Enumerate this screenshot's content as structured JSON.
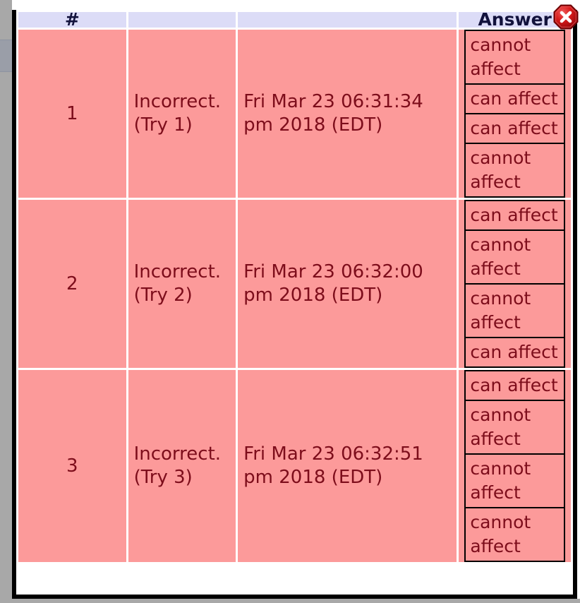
{
  "window": {
    "close_icon": "close-octagon-icon",
    "close_color": "#cf1017"
  },
  "colors": {
    "header_bg": "#dcdcf7",
    "header_text": "#12123c",
    "cell_bg": "#fc9a9a",
    "cell_text": "#7d0d1b",
    "table_border": "#000000",
    "gutter": "#a8a8a8"
  },
  "table": {
    "headers": {
      "number": "#",
      "status": "",
      "time": "",
      "answer": "Answer"
    },
    "rows": [
      {
        "number": "1",
        "status": "Incorrect. (Try 1)",
        "time": "Fri Mar 23 06:31:34 pm 2018 (EDT)",
        "answers": [
          "cannot affect",
          "can affect",
          "can affect",
          "cannot affect"
        ]
      },
      {
        "number": "2",
        "status": "Incorrect. (Try 2)",
        "time": "Fri Mar 23 06:32:00 pm 2018 (EDT)",
        "answers": [
          "can affect",
          "cannot affect",
          "cannot affect",
          "can affect"
        ]
      },
      {
        "number": "3",
        "status": "Incorrect. (Try 3)",
        "time": "Fri Mar 23 06:32:51 pm 2018 (EDT)",
        "answers": [
          "can affect",
          "cannot affect",
          "cannot affect",
          "cannot affect"
        ]
      }
    ]
  }
}
